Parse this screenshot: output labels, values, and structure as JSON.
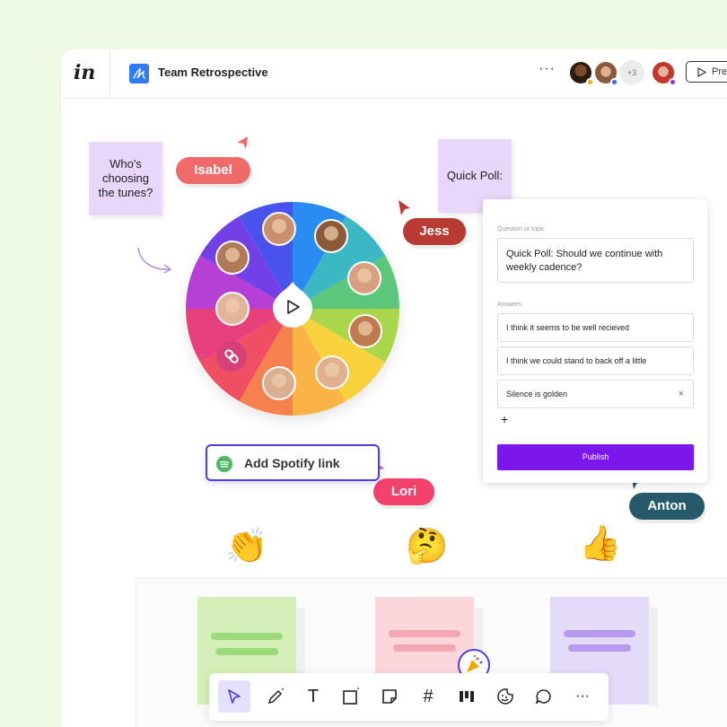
{
  "app": {
    "logo": "in",
    "doc_title": "Team Retrospective",
    "more": "···",
    "participants_extra": "+3",
    "present_label": "Pre"
  },
  "stickies": {
    "tunes": "Who's choosing the tunes?",
    "poll": "Quick Poll:"
  },
  "cursors": [
    {
      "name": "Isabel",
      "color": "#f16a6a"
    },
    {
      "name": "Jess",
      "color": "#b83a32"
    },
    {
      "name": "Lori",
      "color": "#f2416b"
    },
    {
      "name": "Anton",
      "color": "#265a6a"
    }
  ],
  "poll": {
    "question_label": "Question or topic",
    "question": "Quick Poll: Should we continue with weekly cadence?",
    "answers_label": "Answers",
    "answers": [
      "I think it seems to be well recieved",
      "I think we could stand to back off a little",
      "Silence is golden"
    ],
    "remove_icon": "×",
    "add_icon": "+",
    "publish_label": "Publish"
  },
  "spotify": {
    "label": "Add Spotify link"
  },
  "emojis": [
    "👏",
    "🤔",
    "👍"
  ],
  "toolbar": {
    "tools": [
      "select-icon",
      "pencil-icon",
      "text-icon",
      "shape-icon",
      "sticky-note-icon",
      "frame-icon",
      "layout-icon",
      "sticker-icon",
      "comment-icon",
      "more-icon"
    ],
    "text_glyph": "T",
    "frame_glyph": "#",
    "more_glyph": "···"
  },
  "colors": {
    "accent": "#7b16ec",
    "spotify_border": "#4d3de2",
    "sticky_purple": "#e9d6fb",
    "card_green": "#d4f0b8",
    "card_pink": "#fbd7dc",
    "card_lavender": "#e4dbfb"
  }
}
